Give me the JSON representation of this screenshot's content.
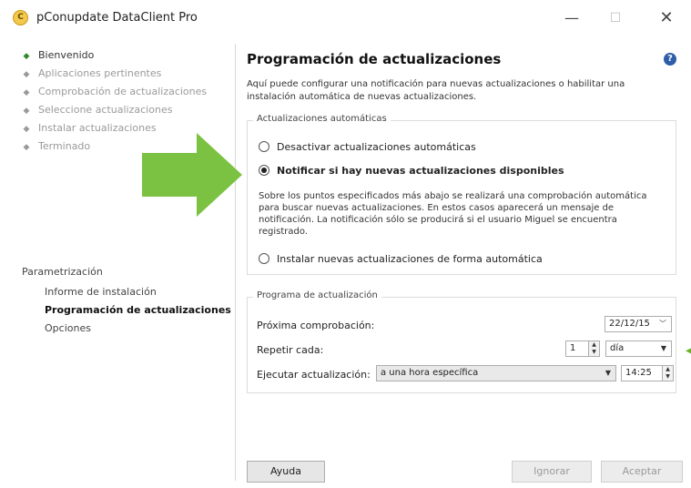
{
  "window": {
    "title": "pConupdate DataClient Pro",
    "icon_letter": "C",
    "controls": {
      "minimize": "—",
      "maximize": "☐",
      "close": "✕"
    }
  },
  "sidebar": {
    "steps": [
      {
        "label": "Bienvenido",
        "active": true
      },
      {
        "label": "Aplicaciones pertinentes",
        "active": false
      },
      {
        "label": "Comprobación de actualizaciones",
        "active": false
      },
      {
        "label": "Seleccione actualizaciones",
        "active": false
      },
      {
        "label": "Instalar actualizaciones",
        "active": false
      },
      {
        "label": "Terminado",
        "active": false
      }
    ],
    "param_header": "Parametrización",
    "param_items": [
      {
        "label": "Informe de instalación",
        "active": false
      },
      {
        "label": "Programación de actualizaciones",
        "active": true
      },
      {
        "label": "Opciones",
        "active": false
      }
    ]
  },
  "main": {
    "title": "Programación de actualizaciones",
    "help_icon": "?",
    "description": "Aquí puede configurar una notificación para nuevas actualizaciones o habilitar una instalación automática de nuevas actualizaciones.",
    "auto_group": {
      "legend": "Actualizaciones automáticas",
      "option_disable": "Desactivar actualizaciones automáticas",
      "option_notify": "Notificar si hay nuevas actualizaciones disponibles",
      "notify_description": "Sobre los puntos especificados más abajo se realizará una comprobación automática para buscar nuevas actualizaciones. En estos casos aparecerá un mensaje de notificación. La notificación sólo se producirá si el usuario Miguel se encuentra registrado.",
      "option_install": "Instalar nuevas actualizaciones de forma automática",
      "selected": "notify"
    },
    "schedule_group": {
      "legend": "Programa de actualización",
      "next_check_label": "Próxima comprobación:",
      "next_check_value": "22/12/15",
      "repeat_label": "Repetir cada:",
      "repeat_value": "1",
      "repeat_unit": "día",
      "run_label": "Ejecutar actualización:",
      "run_value": "a una hora específica",
      "time_value": "14:25"
    }
  },
  "buttons": {
    "help": "Ayuda",
    "ignore": "Ignorar",
    "accept": "Aceptar"
  },
  "colors": {
    "arrow": "#7cc242",
    "accent": "#2f5ea8"
  }
}
